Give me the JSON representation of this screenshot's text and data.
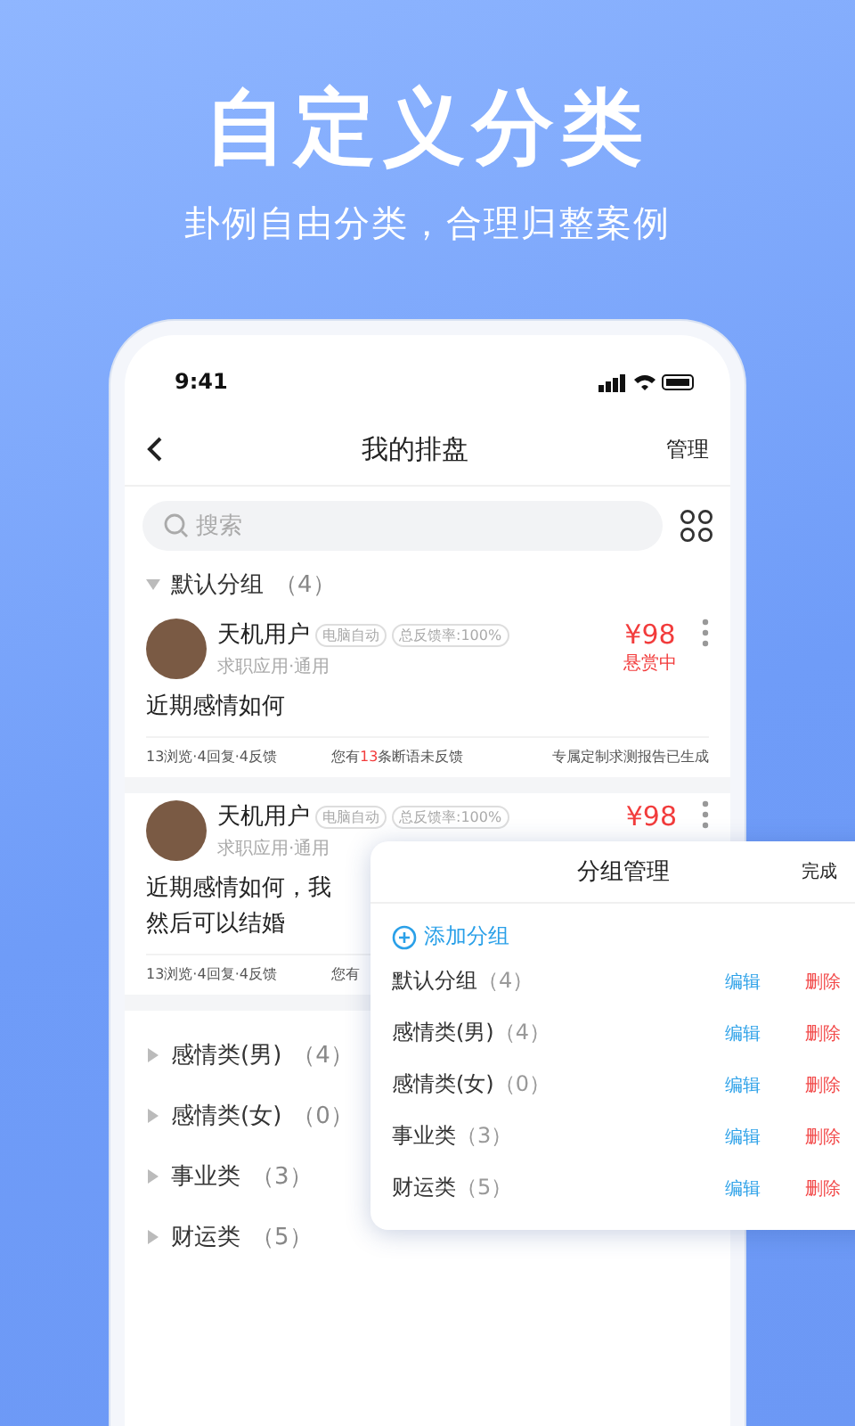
{
  "headline": {
    "title": "自定义分类",
    "subtitle": "卦例自由分类，合理归整案例"
  },
  "status_bar": {
    "time": "9:41"
  },
  "nav": {
    "title": "我的排盘",
    "action": "管理"
  },
  "search": {
    "placeholder": "搜索"
  },
  "group": {
    "name": "默认分组",
    "count": "（4）",
    "expanded": true
  },
  "cards": [
    {
      "user": "天机用户",
      "tags": [
        "电脑自动",
        "总反馈率:100%"
      ],
      "category": "求职应用·通用",
      "price": "¥98",
      "status": "悬赏中",
      "question": [
        "近期感情如何"
      ],
      "stats": "13浏览·4回复·4反馈",
      "notice": [
        "您有",
        "13",
        "条断语未反馈"
      ],
      "report": "专属定制求测报告已生成"
    },
    {
      "user": "天机用户",
      "tags": [
        "电脑自动",
        "总反馈率:100%"
      ],
      "category": "求职应用·通用",
      "price": "¥98",
      "question": [
        "近期感情如何，我",
        "然后可以结婚"
      ],
      "stats": "13浏览·4回复·4反馈",
      "notice": [
        "您有"
      ]
    }
  ],
  "other_groups": [
    {
      "name": "感情类(男)",
      "count": "（4）",
      "expanded": false
    },
    {
      "name": "感情类(女)",
      "count": "（0）",
      "expanded": false
    },
    {
      "name": "事业类",
      "count": "（3）",
      "expanded": false
    },
    {
      "name": "财运类",
      "count": "（5）",
      "expanded": false
    }
  ],
  "manager": {
    "title": "分组管理",
    "done": "完成",
    "add": "添加分组",
    "groups": [
      {
        "name": "默认分组",
        "count": "（4）",
        "edit": "编辑",
        "delete": "删除"
      },
      {
        "name": "感情类(男)",
        "count": "（4）",
        "edit": "编辑",
        "delete": "删除"
      },
      {
        "name": "感情类(女)",
        "count": "（0）",
        "edit": "编辑",
        "delete": "删除"
      },
      {
        "name": "事业类",
        "count": "（3）",
        "edit": "编辑",
        "delete": "删除"
      },
      {
        "name": "财运类",
        "count": "（5）",
        "edit": "编辑",
        "delete": "删除"
      }
    ]
  }
}
